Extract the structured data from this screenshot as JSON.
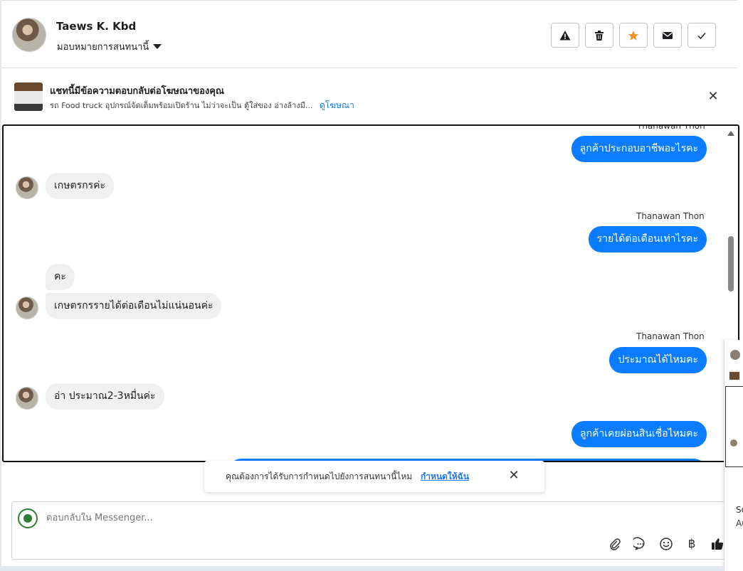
{
  "header": {
    "name": "Taews K. Kbd",
    "assign_label": "มอบหมายการสนทนานี้"
  },
  "ad_banner": {
    "title": "แชทนี้มีข้อความตอบกลับต่อโฆษณาของคุณ",
    "subtitle": "รถ Food truck อุปกรณ์จัดเต็มพร้อมเปิดร้าน ไม่ว่าจะเป็น ตู้ใส่ของ อ่างล้างมื...",
    "link": "ดูโฆษณา",
    "close": "✕"
  },
  "messages": {
    "m0_sender": "Thanawan Thon",
    "m0_text": "ลูกค้าประกอบอาชีพอะไรคะ",
    "m1_text": "เกษตรกรค่ะ",
    "m2_sender": "Thanawan Thon",
    "m2_text": "รายได้ต่อเดือนเท่าไรคะ",
    "m3_text": "คะ",
    "m4_text": "เกษตรกรรายได้ต่อเดือนไม่แน่นอนค่ะ",
    "m5_sender": "Thanawan Thon",
    "m5_text": "ประมาณได้ไหมคะ",
    "m6_text": "อ่า ประมาณ2-3หมื่นค่ะ",
    "m7_text": "ลูกค้าเคยผ่อนสินเชื่อไหมคะ"
  },
  "toast": {
    "text": "คุณต้องการได้รับการกำหนดไปยังการสนทนานี้ไหม",
    "link": "กำหนดให้ฉัน",
    "close": "✕"
  },
  "composer": {
    "placeholder": "ตอบกลับใน Messenger...",
    "baht_symbol": "฿"
  },
  "edge_panel": {
    "text1": "So",
    "text2": "Au"
  }
}
